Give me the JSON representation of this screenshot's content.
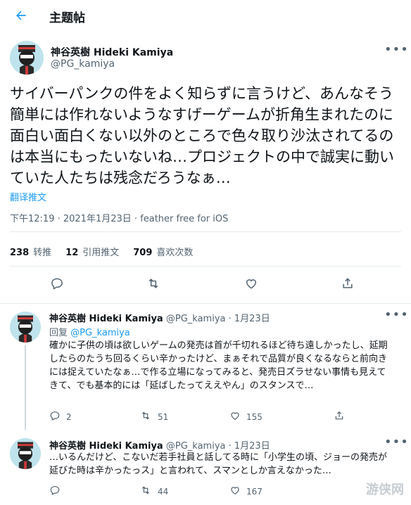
{
  "header": {
    "title": "主题帖"
  },
  "main": {
    "name": "神谷英樹 Hideki Kamiya",
    "handle": "@PG_kamiya",
    "text": "サイバーパンクの件をよく知らずに言うけど、あんなそう簡単には作れないようなすげーゲームが折角生まれたのに面白い面白くない以外のところで色々取り沙汰されてるのは本当にもったいないね…プロジェクトの中で誠実に動いていた人たちは残念だろうなぁ…",
    "translate": "翻译推文",
    "meta": "下午12:19 · 2021年1月23日 · feather free for iOS",
    "stats": [
      {
        "value": "238",
        "label": "转推"
      },
      {
        "value": "12",
        "label": "引用推文"
      },
      {
        "value": "709",
        "label": "喜欢次数"
      }
    ]
  },
  "replies": [
    {
      "name": "神谷英樹 Hideki Kamiya",
      "handle": "@PG_kamiya",
      "date": "· 1月23日",
      "reply_to_label": "回复",
      "reply_to_handle": "@PG_kamiya",
      "text": "確かに子供の頃は欲しいゲームの発売は首が千切れるほど待ち遠しかったし、延期したらのたうち回るくらい辛かったけど、まぁそれで品質が良くなるならと前向きには捉えていたなぁ…で作る立場になってみると、発売日ズラせない事情も見えてきて、でも基本的には「延ばしたってええやん」のスタンスで…",
      "reply_count": "2",
      "retweet_count": "51",
      "like_count": "155"
    },
    {
      "name": "神谷英樹 Hideki Kamiya",
      "handle": "@PG_kamiya",
      "date": "· 1月23日",
      "text": "…いるんだけど、こないだ若手社員と話してる時に「小学生の頃、ジョーの発売が延びた時は辛かったっス」と言われて、スマンとしか言えなかった…",
      "reply_count": "",
      "retweet_count": "44",
      "like_count": "167"
    }
  ],
  "watermark": "游侠网"
}
